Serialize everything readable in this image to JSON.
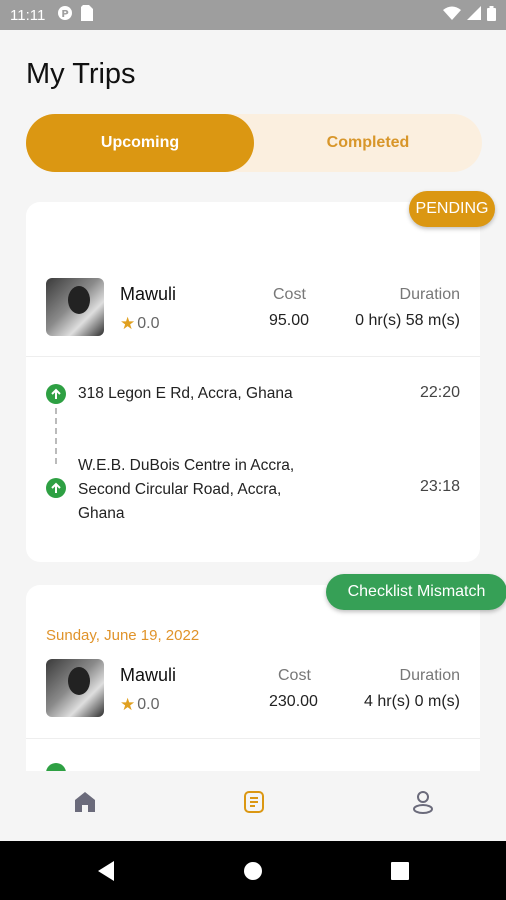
{
  "status_bar": {
    "time": "11:11"
  },
  "page_title": "My Trips",
  "tabs": [
    {
      "label": "Upcoming",
      "active": true
    },
    {
      "label": "Completed",
      "active": false
    }
  ],
  "trips": [
    {
      "status": "PENDING",
      "status_color": "#db9712",
      "driver_name": "Mawuli",
      "rating": "0.0",
      "cost_label": "Cost",
      "cost": "95.00",
      "duration_label": "Duration",
      "duration": "0 hr(s) 58 m(s)",
      "stops": [
        {
          "address": "318 Legon E Rd, Accra, Ghana",
          "time": "22:20"
        },
        {
          "address_lines": [
            "W.E.B. DuBois Centre in Accra,",
            "Second Circular Road, Accra,",
            "Ghana"
          ],
          "time": "23:18"
        }
      ]
    },
    {
      "status": "Checklist Mismatch",
      "status_color": "#36a056",
      "date": "Sunday, June 19, 2022",
      "driver_name": "Mawuli",
      "rating": "0.0",
      "cost_label": "Cost",
      "cost": "230.00",
      "duration_label": "Duration",
      "duration": "4 hr(s) 0 m(s)"
    }
  ],
  "bottom_nav": [
    {
      "icon": "home-icon",
      "active": false
    },
    {
      "icon": "trips-list-icon",
      "active": true
    },
    {
      "icon": "profile-icon",
      "active": false
    }
  ],
  "colors": {
    "accent": "#db9712",
    "accent_light": "#fbefdf",
    "success": "#36a056"
  }
}
